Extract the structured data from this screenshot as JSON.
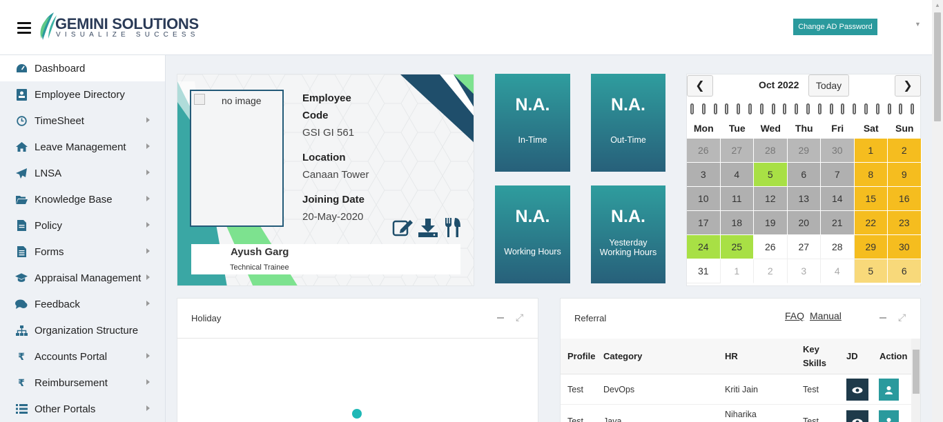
{
  "header": {
    "logo_title": "GEMINI SOLUTIONS",
    "logo_tagline": "VISUALIZE SUCCESS",
    "change_password_label": "Change AD Password"
  },
  "sidebar": {
    "items": [
      {
        "label": "Dashboard",
        "icon": "dashboard-icon",
        "active": true
      },
      {
        "label": "Employee Directory",
        "icon": "id-card-icon"
      },
      {
        "label": "TimeSheet",
        "icon": "clock-icon"
      },
      {
        "label": "Leave Management",
        "icon": "home-icon"
      },
      {
        "label": "LNSA",
        "icon": "paper-plane-icon"
      },
      {
        "label": "Knowledge Base",
        "icon": "folder-open-icon"
      },
      {
        "label": "Policy",
        "icon": "document-icon"
      },
      {
        "label": "Forms",
        "icon": "form-icon"
      },
      {
        "label": "Appraisal Management",
        "icon": "graduation-cap-icon"
      },
      {
        "label": "Feedback",
        "icon": "comments-icon"
      },
      {
        "label": "Organization Structure",
        "icon": "sitemap-icon"
      },
      {
        "label": "Accounts Portal",
        "icon": "rupee-icon"
      },
      {
        "label": "Reimbursement",
        "icon": "rupee-icon"
      },
      {
        "label": "Other Portals",
        "icon": "list-icon"
      }
    ]
  },
  "employee_card": {
    "photo_alt": "no image",
    "code_label_1": "Employee",
    "code_label_2": "Code",
    "code_value": "GSI GI 561",
    "location_label": "Location",
    "location_value": "Canaan Tower",
    "joining_label": "Joining Date",
    "joining_value": "20-May-2020",
    "name": "Ayush Garg",
    "designation": "Technical Trainee"
  },
  "tiles": {
    "in_time": {
      "value": "N.A.",
      "label": "In-Time"
    },
    "out_time": {
      "value": "N.A.",
      "label": "Out-Time"
    },
    "working_hours": {
      "value": "N.A.",
      "label": "Working Hours"
    },
    "yesterday_hours": {
      "value": "N.A.",
      "label_1": "Yesterday",
      "label_2": "Working Hours"
    }
  },
  "calendar": {
    "month": "Oct 2022",
    "today_label": "Today",
    "prev": "❮",
    "next": "❯",
    "weekdays": [
      "Mon",
      "Tue",
      "Wed",
      "Thu",
      "Fri",
      "Sat",
      "Sun"
    ],
    "weeks": [
      [
        [
          "26",
          "gm"
        ],
        [
          "27",
          "gm"
        ],
        [
          "28",
          "gm"
        ],
        [
          "29",
          "gm"
        ],
        [
          "30",
          "gm"
        ],
        [
          "1",
          "y"
        ],
        [
          "2",
          "y"
        ]
      ],
      [
        [
          "3",
          "g"
        ],
        [
          "4",
          "g"
        ],
        [
          "5",
          "gr"
        ],
        [
          "6",
          "g"
        ],
        [
          "7",
          "g"
        ],
        [
          "8",
          "y"
        ],
        [
          "9",
          "y"
        ]
      ],
      [
        [
          "10",
          "g"
        ],
        [
          "11",
          "g"
        ],
        [
          "12",
          "g"
        ],
        [
          "13",
          "g"
        ],
        [
          "14",
          "g"
        ],
        [
          "15",
          "y"
        ],
        [
          "16",
          "y"
        ]
      ],
      [
        [
          "17",
          "g"
        ],
        [
          "18",
          "g"
        ],
        [
          "19",
          "g"
        ],
        [
          "20",
          "g"
        ],
        [
          "21",
          "g"
        ],
        [
          "22",
          "y"
        ],
        [
          "23",
          "y"
        ]
      ],
      [
        [
          "24",
          "gr"
        ],
        [
          "25",
          "gr"
        ],
        [
          "26",
          "w"
        ],
        [
          "27",
          "w"
        ],
        [
          "28",
          "w"
        ],
        [
          "29",
          "y"
        ],
        [
          "30",
          "y"
        ]
      ],
      [
        [
          "31",
          "w"
        ],
        [
          "1",
          "wm"
        ],
        [
          "2",
          "wm"
        ],
        [
          "3",
          "wm"
        ],
        [
          "4",
          "wm"
        ],
        [
          "5",
          "yl"
        ],
        [
          "6",
          "yl"
        ]
      ]
    ]
  },
  "holiday_panel": {
    "title": "Holiday"
  },
  "referral_panel": {
    "title": "Referral",
    "faq": "FAQ",
    "manual": "Manual",
    "columns": [
      "Profile",
      "Category",
      "HR",
      "Key",
      "Skills",
      "JD",
      "Action"
    ],
    "rows": [
      {
        "profile": "Test",
        "category": "DevOps",
        "hr": "Kriti Jain",
        "skills": "Test"
      },
      {
        "profile": "Test",
        "category": "Java",
        "hr": "Niharika",
        "skills": "Test"
      }
    ]
  }
}
